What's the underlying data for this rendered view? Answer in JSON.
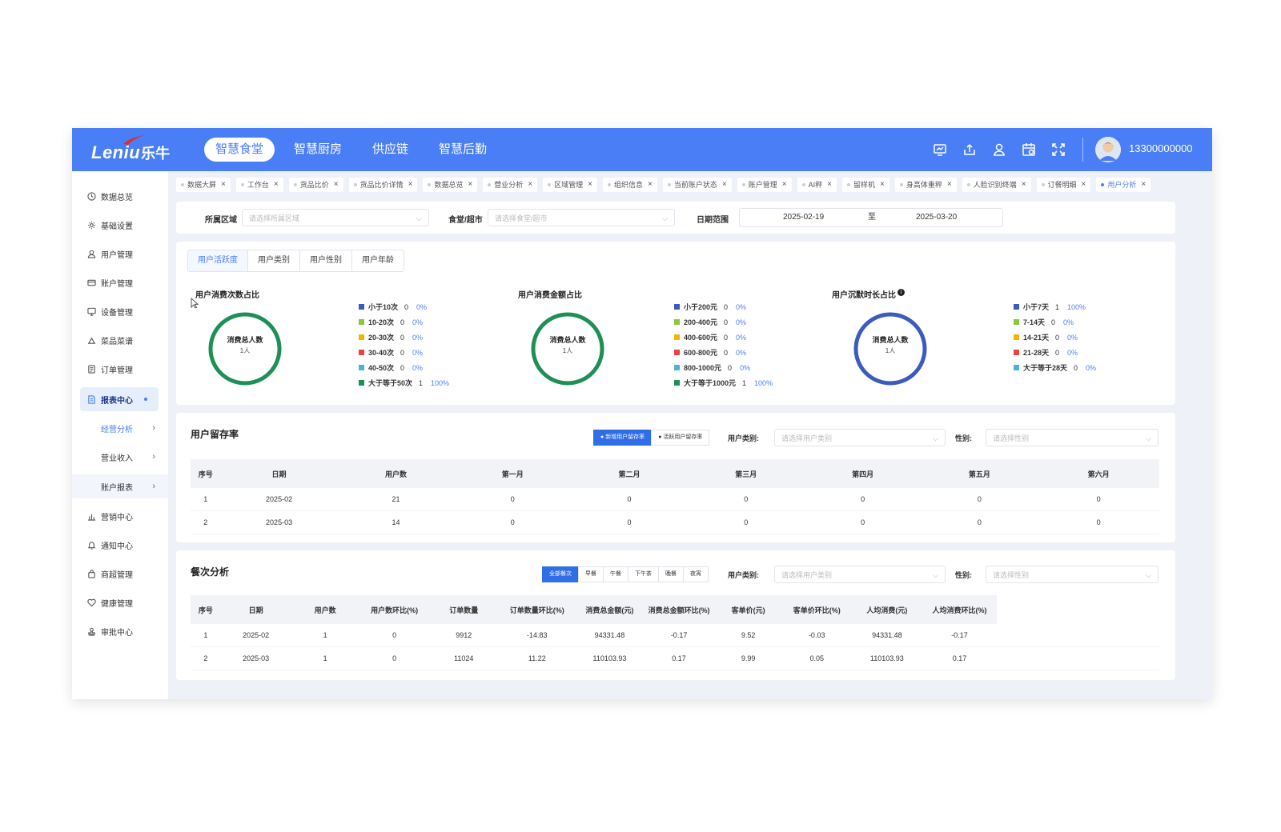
{
  "header": {
    "logo_en": "Leniu",
    "logo_cn": "乐牛",
    "nav": [
      "智慧食堂",
      "智慧厨房",
      "供应链",
      "智慧后勤"
    ],
    "username": "13300000000",
    "icons": [
      "monitor-icon",
      "upload-icon",
      "user-icon",
      "calendar-icon",
      "fullscreen-icon"
    ]
  },
  "sidebar": {
    "items": [
      "数据总览",
      "基础设置",
      "用户管理",
      "账户管理",
      "设备管理",
      "菜品菜谱",
      "订单管理",
      "报表中心"
    ],
    "subitems": [
      "经营分析",
      "营业收入",
      "账户报表"
    ],
    "items_after": [
      "营销中心",
      "通知中心",
      "商超管理",
      "健康管理",
      "审批中心"
    ]
  },
  "tabs": [
    "数据大屏",
    "工作台",
    "货品比价",
    "货品比价详情",
    "数据总览",
    "营业分析",
    "区域管理",
    "组织信息",
    "当前账户状态",
    "账户管理",
    "AI秤",
    "留样机",
    "身高体重秤",
    "人脸识别终端",
    "订餐明细",
    "用户分析"
  ],
  "filters": {
    "area_label": "所属区域",
    "area_placeholder": "请选择所属区域",
    "canteen_label": "食堂/超市",
    "canteen_placeholder": "请选择食堂/超市",
    "date_label": "日期范围",
    "date_start": "2025-02-19",
    "date_sep": "至",
    "date_end": "2025-03-20"
  },
  "subtabs": [
    "用户活跃度",
    "用户类别",
    "用户性别",
    "用户年龄"
  ],
  "donuts": [
    {
      "title": "用户消费次数占比",
      "center_label": "消费总人数",
      "center_value": "1人",
      "color": "#1e8f57",
      "legend": [
        {
          "name": "小于10次",
          "count": "0",
          "pct": "0%",
          "color": "#3b5bbf"
        },
        {
          "name": "10-20次",
          "count": "0",
          "pct": "0%",
          "color": "#8cc63f"
        },
        {
          "name": "20-30次",
          "count": "0",
          "pct": "0%",
          "color": "#f5b400"
        },
        {
          "name": "30-40次",
          "count": "0",
          "pct": "0%",
          "color": "#e8453c"
        },
        {
          "name": "40-50次",
          "count": "0",
          "pct": "0%",
          "color": "#4bb3d9"
        },
        {
          "name": "大于等于50次",
          "count": "1",
          "pct": "100%",
          "color": "#1e8f57"
        }
      ]
    },
    {
      "title": "用户消费金额占比",
      "center_label": "消费总人数",
      "center_value": "1人",
      "color": "#1e8f57",
      "legend": [
        {
          "name": "小于200元",
          "count": "0",
          "pct": "0%",
          "color": "#3b5bbf"
        },
        {
          "name": "200-400元",
          "count": "0",
          "pct": "0%",
          "color": "#8cc63f"
        },
        {
          "name": "400-600元",
          "count": "0",
          "pct": "0%",
          "color": "#f5b400"
        },
        {
          "name": "600-800元",
          "count": "0",
          "pct": "0%",
          "color": "#e8453c"
        },
        {
          "name": "800-1000元",
          "count": "0",
          "pct": "0%",
          "color": "#4bb3d9"
        },
        {
          "name": "大于等于1000元",
          "count": "1",
          "pct": "100%",
          "color": "#1e8f57"
        }
      ]
    },
    {
      "title": "用户沉默时长占比",
      "center_label": "消费总人数",
      "center_value": "1人",
      "color": "#3b5bbf",
      "legend": [
        {
          "name": "小于7天",
          "count": "1",
          "pct": "100%",
          "color": "#3b5bbf"
        },
        {
          "name": "7-14天",
          "count": "0",
          "pct": "0%",
          "color": "#8cc63f"
        },
        {
          "name": "14-21天",
          "count": "0",
          "pct": "0%",
          "color": "#f5b400"
        },
        {
          "name": "21-28天",
          "count": "0",
          "pct": "0%",
          "color": "#e8453c"
        },
        {
          "name": "大于等于28天",
          "count": "0",
          "pct": "0%",
          "color": "#4bb3d9"
        }
      ]
    }
  ],
  "retention": {
    "title": "用户留存率",
    "buttons": [
      "新增用户留存率",
      "活跃用户留存率"
    ],
    "user_type_label": "用户类别:",
    "user_type_placeholder": "请选择用户类别",
    "gender_label": "性别:",
    "gender_placeholder": "请选择性别",
    "columns": [
      "序号",
      "日期",
      "用户数",
      "第一月",
      "第二月",
      "第三月",
      "第四月",
      "第五月",
      "第六月"
    ],
    "rows": [
      [
        "1",
        "2025-02",
        "21",
        "0",
        "0",
        "0",
        "0",
        "0",
        "0"
      ],
      [
        "2",
        "2025-03",
        "14",
        "0",
        "0",
        "0",
        "0",
        "0",
        "0"
      ]
    ]
  },
  "meals": {
    "title": "餐次分析",
    "buttons": [
      "全部餐次",
      "早餐",
      "午餐",
      "下午茶",
      "晚餐",
      "夜宵"
    ],
    "user_type_label": "用户类别:",
    "user_type_placeholder": "请选择用户类别",
    "gender_label": "性别:",
    "gender_placeholder": "请选择性别",
    "columns": [
      "序号",
      "日期",
      "用户数",
      "用户数环比(%)",
      "订单数量",
      "订单数量环比(%)",
      "消费总金额(元)",
      "消费总金额环比(%)",
      "客单价(元)",
      "客单价环比(%)",
      "人均消费(元)",
      "人均消费环比(%)"
    ],
    "rows": [
      [
        "1",
        "2025-02",
        "1",
        "0",
        "9912",
        "-14.83",
        "94331.48",
        "-0.17",
        "9.52",
        "-0.03",
        "94331.48",
        "-0.17"
      ],
      [
        "2",
        "2025-03",
        "1",
        "0",
        "11024",
        "11.22",
        "110103.93",
        "0.17",
        "9.99",
        "0.05",
        "110103.93",
        "0.17"
      ]
    ]
  }
}
